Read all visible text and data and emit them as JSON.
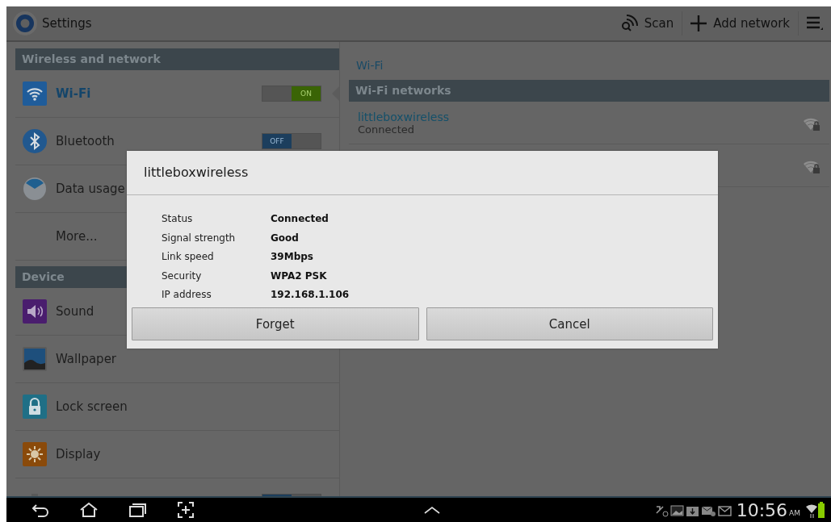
{
  "action_bar": {
    "title": "Settings",
    "actions": [
      {
        "label": "Scan",
        "kind": "scan"
      },
      {
        "label": "Add network",
        "kind": "add"
      }
    ]
  },
  "sidebar": {
    "sections": [
      {
        "title": "Wireless and network",
        "items": [
          {
            "label": "Wi-Fi",
            "kind": "wifi",
            "selected": true,
            "toggle": {
              "on": true,
              "label": "ON"
            }
          },
          {
            "label": "Bluetooth",
            "kind": "bluetooth",
            "selected": false,
            "toggle": {
              "on": false,
              "label": "OFF"
            }
          },
          {
            "label": "Data usage",
            "kind": "data",
            "selected": false
          },
          {
            "label": "More...",
            "kind": "plain",
            "selected": false
          }
        ]
      },
      {
        "title": "Device",
        "items": [
          {
            "label": "Sound",
            "kind": "sound",
            "selected": false
          },
          {
            "label": "Wallpaper",
            "kind": "wallpaper",
            "selected": false
          },
          {
            "label": "Lock screen",
            "kind": "lock",
            "selected": false
          },
          {
            "label": "Display",
            "kind": "display",
            "selected": false
          },
          {
            "kind": "battery",
            "toggle": {
              "on": false
            }
          }
        ]
      }
    ]
  },
  "wifi_pane": {
    "title": "Wi-Fi",
    "list_header": "Wi-Fi networks",
    "networks": [
      {
        "name": "littleboxwireless",
        "status": "Connected",
        "secured": true
      },
      {
        "secured": true
      }
    ]
  },
  "dialog": {
    "title": "littleboxwireless",
    "rows": [
      {
        "label": "Status",
        "value": "Connected"
      },
      {
        "label": "Signal strength",
        "value": "Good"
      },
      {
        "label": "Link speed",
        "value": "39Mbps"
      },
      {
        "label": "Security",
        "value": "WPA2 PSK"
      },
      {
        "label": "IP address",
        "value": "192.168.1.106"
      }
    ],
    "buttons": [
      "Forget",
      "Cancel"
    ]
  },
  "status_bar": {
    "time": "10:56",
    "ampm": "AM"
  }
}
